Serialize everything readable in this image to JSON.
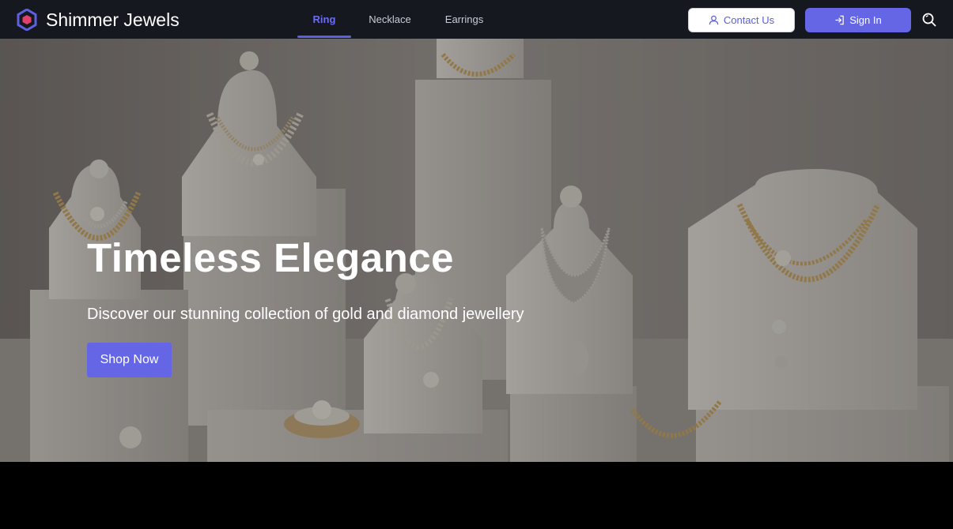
{
  "brand": {
    "name": "Shimmer Jewels",
    "logo_icon": "hexagon-logo-icon",
    "logo_color": "#5e60e0",
    "logo_inner_color": "#e0406a"
  },
  "nav": {
    "tabs": [
      {
        "label": "Ring",
        "active": true
      },
      {
        "label": "Necklace",
        "active": false
      },
      {
        "label": "Earrings",
        "active": false
      }
    ],
    "contact_label": "Contact Us",
    "contact_icon": "user-icon",
    "signin_label": "Sign In",
    "signin_icon": "sign-in-icon",
    "search_icon": "search-icon"
  },
  "hero": {
    "title": "Timeless Elegance",
    "subtitle": "Discover our stunning collection of gold and diamond jewellery",
    "cta_label": "Shop Now"
  },
  "colors": {
    "accent": "#6466e6",
    "nav_bg": "#15191f"
  }
}
